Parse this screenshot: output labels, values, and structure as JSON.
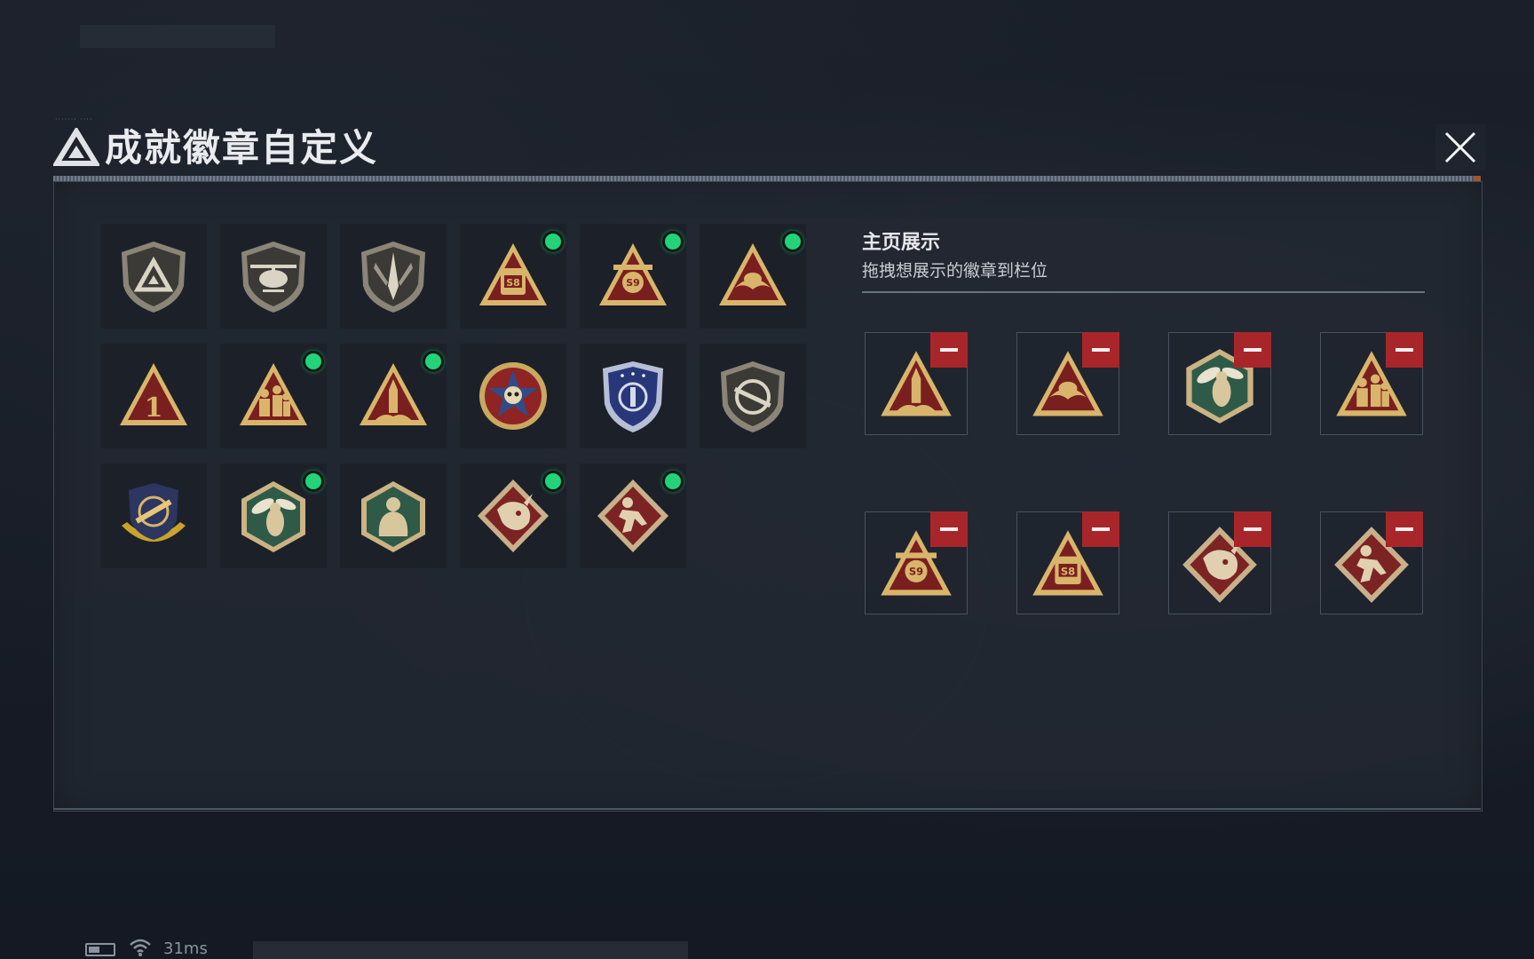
{
  "header": {
    "title": "成就徽章自定义",
    "micro_text": "······· ····"
  },
  "badges": [
    {
      "icon": "shield-delta-icon",
      "new": false
    },
    {
      "icon": "shield-helicopter-icon",
      "new": false
    },
    {
      "icon": "shield-dagger-icon",
      "new": false
    },
    {
      "icon": "triangle-s8-icon",
      "new": true,
      "text": "S8"
    },
    {
      "icon": "triangle-s9-icon",
      "new": true,
      "text": "S9"
    },
    {
      "icon": "triangle-eagle-icon",
      "new": true
    },
    {
      "icon": "triangle-number-one-icon",
      "new": false,
      "text": "1"
    },
    {
      "icon": "triangle-soldiers-icon",
      "new": true
    },
    {
      "icon": "triangle-rocket-icon",
      "new": true
    },
    {
      "icon": "star-skull-medal-icon",
      "new": false
    },
    {
      "icon": "blue-eagle-shield-icon",
      "new": false
    },
    {
      "icon": "shield-rifle-icon",
      "new": false
    },
    {
      "icon": "crosshair-wings-medal-icon",
      "new": false
    },
    {
      "icon": "hexagon-wasp-icon",
      "new": true
    },
    {
      "icon": "hexagon-brute-icon",
      "new": false
    },
    {
      "icon": "diamond-dragon-icon",
      "new": true
    },
    {
      "icon": "diamond-runner-icon",
      "new": true
    }
  ],
  "showcase": {
    "title": "主页展示",
    "subtitle": "拖拽想展示的徽章到栏位",
    "slots": [
      {
        "icon": "triangle-rocket-icon"
      },
      {
        "icon": "triangle-eagle-icon"
      },
      {
        "icon": "hexagon-wasp-icon"
      },
      {
        "icon": "triangle-soldiers-icon"
      },
      {
        "icon": "triangle-s9-icon",
        "text": "S9"
      },
      {
        "icon": "triangle-s8-icon",
        "text": "S8"
      },
      {
        "icon": "diamond-dragon-icon"
      },
      {
        "icon": "diamond-runner-icon"
      }
    ]
  },
  "status": {
    "latency": "31ms"
  },
  "colors": {
    "new_indicator": "#22d37a",
    "remove_button": "#a8262a",
    "gold": "#d8b56a",
    "crimson": "#7a1f1f",
    "hex_green": "#2f5a48"
  }
}
